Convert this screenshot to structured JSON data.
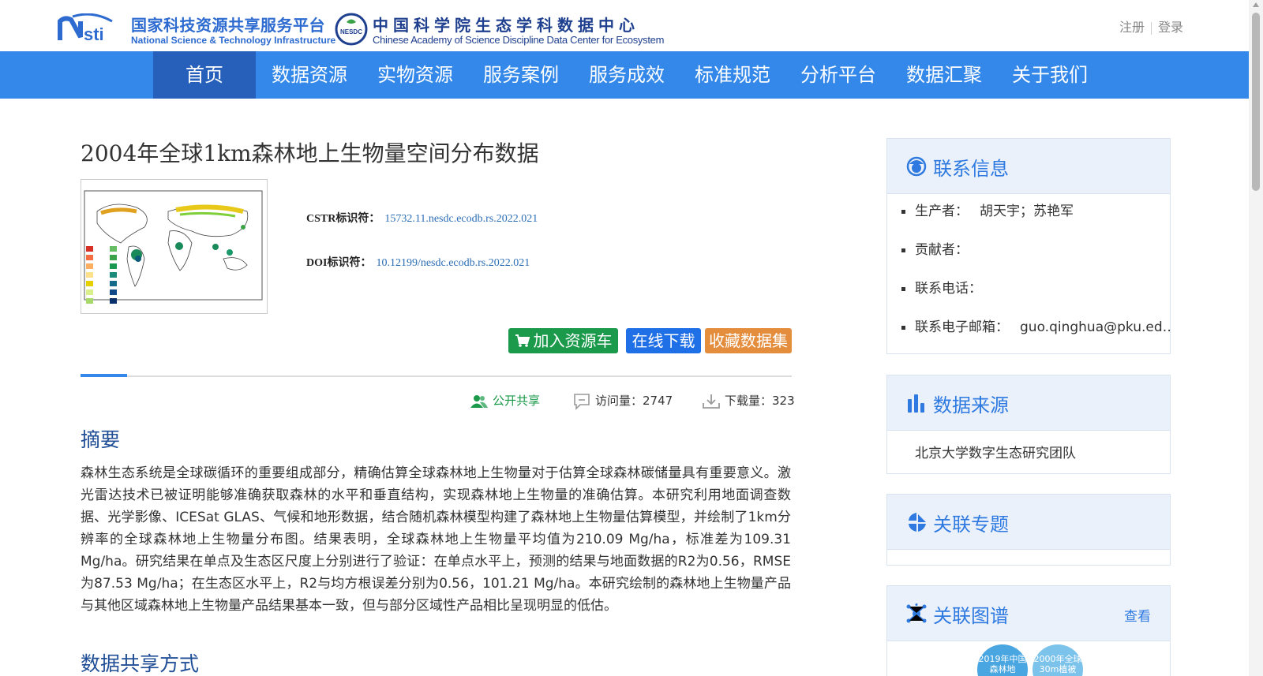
{
  "header": {
    "logo_cn": "国家科技资源共享服务平台",
    "logo_en": "National Science & Technology Infrastructure",
    "nesdc_badge": "NESDC",
    "nesdc_cn": "中国科学院生态学科数据中心",
    "nesdc_en": "Chinese Academy of Science Discipline Data Center for Ecosystem",
    "register": "注册",
    "login": "登录"
  },
  "nav": {
    "items": [
      "首页",
      "数据资源",
      "实物资源",
      "服务案例",
      "服务成效",
      "标准规范",
      "分析平台",
      "数据汇聚",
      "关于我们"
    ],
    "active": "首页"
  },
  "dataset": {
    "title": "2004年全球1km森林地上生物量空间分布数据",
    "cstr_label": "CSTR标识符：",
    "cstr_value": "15732.11.nesdc.ecodb.rs.2022.021",
    "doi_label": "DOI标识符：",
    "doi_value": "10.12199/nesdc.ecodb.rs.2022.021"
  },
  "actions": {
    "cart": "加入资源车",
    "download": "在线下载",
    "favorite": "收藏数据集"
  },
  "stats": {
    "share": "公开共享",
    "visits": "访问量：2747",
    "downloads": "下载量：323"
  },
  "abstract": {
    "heading": "摘要",
    "text": "森林生态系统是全球碳循环的重要组成部分，精确估算全球森林地上生物量对于估算全球森林碳储量具有重要意义。激光雷达技术已被证明能够准确获取森林的水平和垂直结构，实现森林地上生物量的准确估算。本研究利用地面调查数据、光学影像、ICESat GLAS、气候和地形数据，结合随机森林模型构建了森林地上生物量估算模型，并绘制了1km分辨率的全球森林地上生物量分布图。结果表明，全球森林地上生物量平均值为210.09 Mg/ha，标准差为109.31 Mg/ha。研究结果在单点及生态区尺度上分别进行了验证：在单点水平上，预测的结果与地面数据的R2为0.56，RMSE为87.53 Mg/ha；在生态区水平上，R2与均方根误差分别为0.56，101.21 Mg/ha。本研究绘制的森林地上生物量产品与其他区域森林地上生物量产品结果基本一致，但与部分区域性产品相比呈现明显的低估。"
  },
  "sharing": {
    "heading": "数据共享方式"
  },
  "contact": {
    "title": "联系信息",
    "producer_label": "生产者：",
    "producer_value": "胡天宇；苏艳军",
    "contributor_label": "贡献者：",
    "phone_label": "联系电话：",
    "email_label": "联系电子邮箱：",
    "email_value": "guo.qinghua@pku.ed…"
  },
  "source": {
    "title": "数据来源",
    "value": "北京大学数字生态研究团队"
  },
  "topics": {
    "title": "关联专题"
  },
  "graph": {
    "title": "关联图谱",
    "more": "查看",
    "nodes": [
      "2019年中国森林地",
      "2000年全球30m植被"
    ]
  },
  "colors": {
    "nav_bg": "#3388e9",
    "nav_active": "#2760bb",
    "accent": "#2e7ae0",
    "cart_green": "#1a9a4a",
    "download_blue": "#1f6fe6",
    "favorite_orange": "#e38d3d"
  }
}
